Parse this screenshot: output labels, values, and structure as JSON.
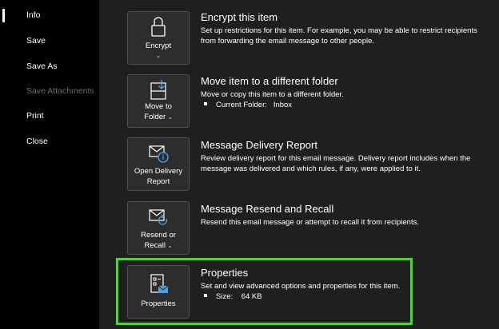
{
  "nav": {
    "items": [
      {
        "label": "Info",
        "selected": true,
        "enabled": true
      },
      {
        "label": "Save",
        "selected": false,
        "enabled": true
      },
      {
        "label": "Save As",
        "selected": false,
        "enabled": true
      },
      {
        "label": "Save Attachments",
        "selected": false,
        "enabled": false
      },
      {
        "label": "Print",
        "selected": false,
        "enabled": true
      },
      {
        "label": "Close",
        "selected": false,
        "enabled": true
      }
    ]
  },
  "sections": {
    "encrypt": {
      "button_line1": "Encrypt",
      "button_chevron": "⌄",
      "title": "Encrypt this item",
      "description": "Set up restrictions for this item. For example, you may be able to restrict recipients from forwarding the email message to other people."
    },
    "move": {
      "button_line1": "Move to",
      "button_line2": "Folder",
      "button_chevron": "⌄",
      "title": "Move item to a different folder",
      "description": "Move or copy this item to a different folder.",
      "bullet_label": "Current Folder:",
      "bullet_value": "Inbox"
    },
    "delivery": {
      "button_line1": "Open Delivery",
      "button_line2": "Report",
      "title": "Message Delivery Report",
      "description": "Review delivery report for this email message. Delivery report includes when the message was delivered and which rules, if any, were applied to it."
    },
    "resend": {
      "button_line1": "Resend or",
      "button_line2": "Recall",
      "button_chevron": "⌄",
      "title": "Message Resend and Recall",
      "description": "Resend this email message or attempt to recall it from recipients."
    },
    "properties": {
      "button_line1": "Properties",
      "title": "Properties",
      "description": "Set and view advanced options and properties for this item.",
      "bullet_label": "Size:",
      "bullet_value": "64 KB"
    }
  },
  "colors": {
    "sidebar_bg": "#000000",
    "main_bg": "#1f1f1f",
    "tile_bg": "#2d2d2d",
    "highlight": "#39e31d",
    "icon_accent": "#4aa3e8"
  }
}
